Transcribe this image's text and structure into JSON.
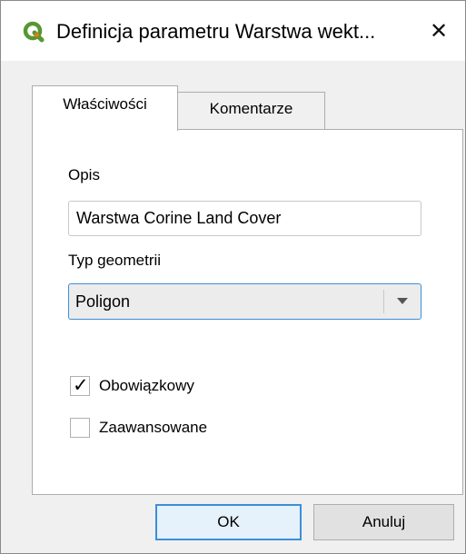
{
  "window": {
    "title": "Definicja parametru Warstwa wekt...",
    "app_icon": "qgis-logo-icon",
    "close_symbol": "✕"
  },
  "tabs": [
    {
      "label": "Właściwości",
      "active": true
    },
    {
      "label": "Komentarze",
      "active": false
    }
  ],
  "form": {
    "description_label": "Opis",
    "description_value": "Warstwa Corine Land Cover",
    "geometry_label": "Typ geometrii",
    "geometry_value": "Poligon",
    "mandatory_label": "Obowiązkowy",
    "mandatory_checked": true,
    "mandatory_check_symbol": "✓",
    "advanced_label": "Zaawansowane",
    "advanced_checked": false
  },
  "buttons": {
    "ok_label": "OK",
    "cancel_label": "Anuluj"
  },
  "colors": {
    "accent": "#3c8fd8",
    "logo_green": "#589632",
    "logo_yellow": "#ee7913"
  }
}
